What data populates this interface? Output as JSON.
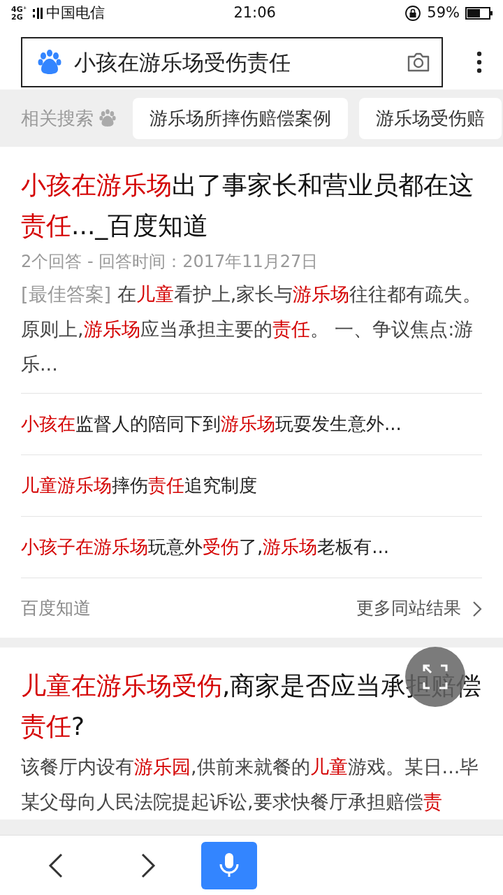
{
  "status_bar": {
    "network": "4G⁺ 2G",
    "carrier": "中国电信",
    "time": "21:06",
    "battery_percent": "59%"
  },
  "search": {
    "value": "小孩在游乐场受伤责任"
  },
  "related": {
    "label": "相关搜索",
    "items": [
      "游乐场所摔伤赔偿案例",
      "游乐场受伤赔"
    ]
  },
  "results": [
    {
      "title": "**小孩在游乐场**出了事家长和营业员都在这**责任**..._百度知道",
      "meta": "2个回答 - 回答时间：2017年11月27日",
      "tag": "[最佳答案]",
      "snippet": "在**儿童**看护上,家长与**游乐场**往往都有疏失。原则上,**游乐场**应当承担主要的**责任**。 一、争议焦点:游乐...",
      "links": [
        "**小孩在**监督人的陪同下到**游乐场**玩耍发生意外...",
        "**儿童游乐场**摔伤**责任**追究制度",
        "**小孩子在游乐场**玩意外**受伤**了,**游乐场**老板有..."
      ],
      "source": "百度知道",
      "more": "更多同站结果"
    },
    {
      "title": "**儿童在游乐场受伤**,商家是否应当承担赔偿**责任**?",
      "snippet": "该餐厅内设有**游乐园**,供前来就餐的**儿童**游戏。某日...毕某父母向人民法院提起诉讼,要求快餐厅承担赔偿**责**"
    }
  ]
}
